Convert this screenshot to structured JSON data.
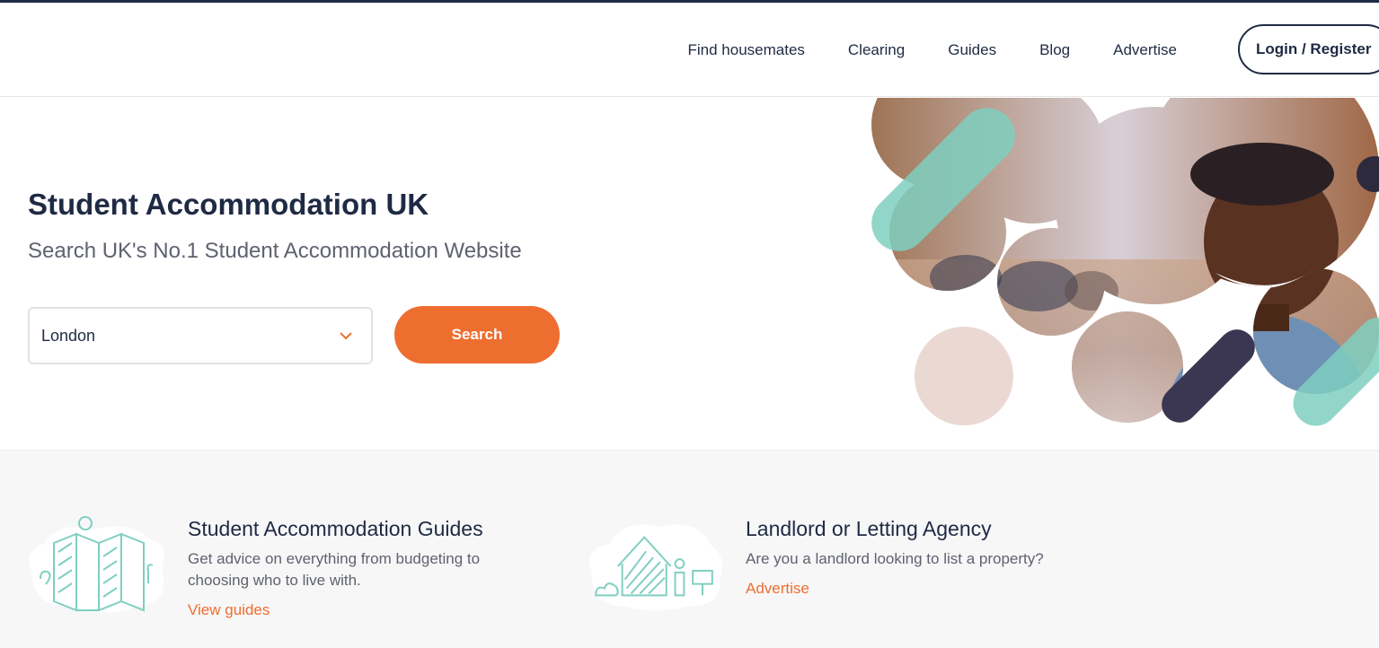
{
  "nav": {
    "items": [
      "Find housemates",
      "Clearing",
      "Guides",
      "Blog",
      "Advertise"
    ],
    "login_label": "Login / Register"
  },
  "hero": {
    "title": "Student Accommodation UK",
    "subtitle": "Search UK's No.1 Student Accommodation Website",
    "location_value": "London",
    "search_label": "Search"
  },
  "cards": {
    "guides": {
      "title": "Student Accommodation Guides",
      "text": "Get advice on everything from budgeting to choosing who to live with.",
      "link": "View guides"
    },
    "landlord": {
      "title": "Landlord or Letting Agency",
      "text": "Are you a landlord looking to list a property?",
      "link": "Advertise"
    }
  },
  "colors": {
    "brand_navy": "#1f2a44",
    "accent_orange": "#ee6e30",
    "teal": "#7fcfc0",
    "muted_text": "#5f6270"
  }
}
